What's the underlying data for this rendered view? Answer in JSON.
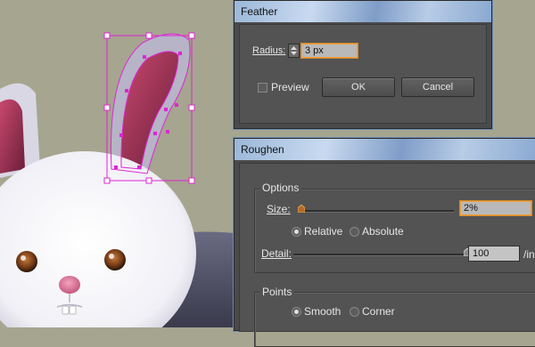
{
  "feather": {
    "title": "Feather",
    "radius_label": "Radius:",
    "radius_value": "3 px",
    "preview_label": "Preview",
    "preview_checked": false,
    "ok_label": "OK",
    "cancel_label": "Cancel"
  },
  "roughen": {
    "title": "Roughen",
    "options_label": "Options",
    "size_label": "Size:",
    "size_value": "2%",
    "size_percent": 2,
    "relative_label": "Relative",
    "absolute_label": "Absolute",
    "selected_mode": "Relative",
    "detail_label": "Detail:",
    "detail_value": "100",
    "detail_unit": "/in",
    "detail_level": 100,
    "points_label": "Points",
    "smooth_label": "Smooth",
    "corner_label": "Corner",
    "selected_points": "Smooth"
  },
  "colors": {
    "selection": "#e024d6",
    "field_focus": "#f0a040",
    "background": "#a6a58f"
  }
}
